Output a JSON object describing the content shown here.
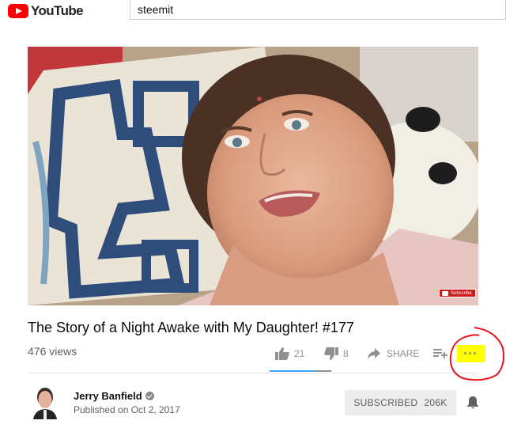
{
  "header": {
    "logo_text": "YouTube",
    "search_value": "steemit"
  },
  "video": {
    "watermark": "Subscribe"
  },
  "info": {
    "title": "The Story of a Night Awake with My Daughter! #177",
    "views": "476 views",
    "likes": "21",
    "dislikes": "8",
    "share_label": "SHARE",
    "like_ratio": 0.72
  },
  "channel": {
    "name": "Jerry Banfield",
    "published": "Published on Oct 2, 2017",
    "subscribed_label": "SUBSCRIBED",
    "subscriber_count": "206K"
  },
  "annotation": {
    "highlight_color": "#ffff00",
    "circle_color": "#e8141c"
  },
  "icons": [
    "youtube-logo-icon",
    "like-icon",
    "dislike-icon",
    "share-icon",
    "add-to-playlist-icon",
    "more-icon",
    "verified-icon",
    "bell-icon"
  ]
}
